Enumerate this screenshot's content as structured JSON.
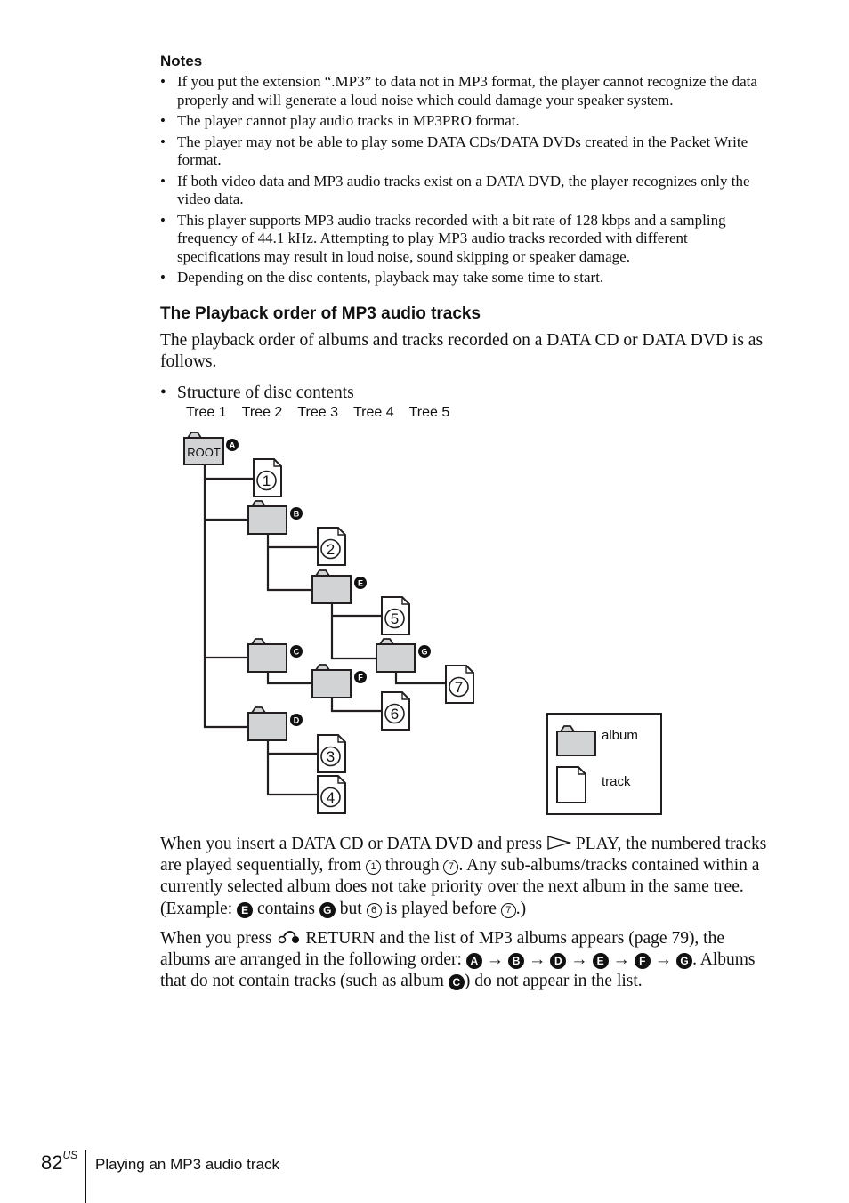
{
  "notes": {
    "heading": "Notes",
    "items": [
      "If you put the extension “.MP3” to data not in MP3 format, the player cannot recognize the data properly and will generate a loud noise which could damage your speaker system.",
      "The player cannot play audio tracks in MP3PRO format.",
      "The player may not be able to play some DATA CDs/DATA DVDs created in the Packet Write format.",
      "If both video data and MP3 audio tracks exist on a DATA DVD, the player recognizes only the video data.",
      "This player supports MP3 audio tracks recorded with a bit rate of 128 kbps and a sampling frequency of 44.1 kHz. Attempting to play MP3 audio tracks recorded with different specifications may result in loud noise, sound skipping or speaker damage.",
      "Depending on the disc contents, playback may take some time to start."
    ]
  },
  "section": {
    "title": "The Playback order of MP3 audio tracks",
    "intro": "The playback order of albums and tracks recorded on a DATA CD or DATA DVD is as follows.",
    "structure_bullet": "Structure of disc contents"
  },
  "diagram": {
    "tree_labels": [
      "Tree 1",
      "Tree 2",
      "Tree 3",
      "Tree 4",
      "Tree 5"
    ],
    "root_label": "ROOT",
    "albums": [
      "A",
      "B",
      "C",
      "D",
      "E",
      "F",
      "G"
    ],
    "tracks": [
      "1",
      "2",
      "3",
      "4",
      "5",
      "6",
      "7"
    ],
    "legend": {
      "album": "album",
      "track": "track"
    },
    "colors": {
      "folder_fill": "#d2d3d5",
      "stroke": "#231f20"
    }
  },
  "para1": {
    "t1": "When you insert a DATA CD or DATA DVD and press ",
    "t2": " PLAY, the numbered tracks are played sequentially, from ",
    "n1": "1",
    "t3": " through ",
    "n7": "7",
    "t4": ". Any sub-albums/tracks contained within a currently selected album does not take priority over the next album in the same tree. (Example: ",
    "bE": "E",
    "t5": " contains ",
    "bG": "G",
    "t6": " but ",
    "n6": "6",
    "t7": " is played before ",
    "n7b": "7",
    "t8": ".)"
  },
  "para2": {
    "t1": "When you press ",
    "t2": " RETURN and the list of MP3 albums appears (page 79), the albums are arranged in the following order: ",
    "order": [
      "A",
      "B",
      "D",
      "E",
      "F",
      "G"
    ],
    "arrow": "→",
    "t3": ". Albums that do not contain tracks (such as album ",
    "bC": "C",
    "t4": ") do not appear in the list."
  },
  "footer": {
    "page_number": "82",
    "page_suffix": "US",
    "section_title": "Playing an MP3 audio track"
  }
}
